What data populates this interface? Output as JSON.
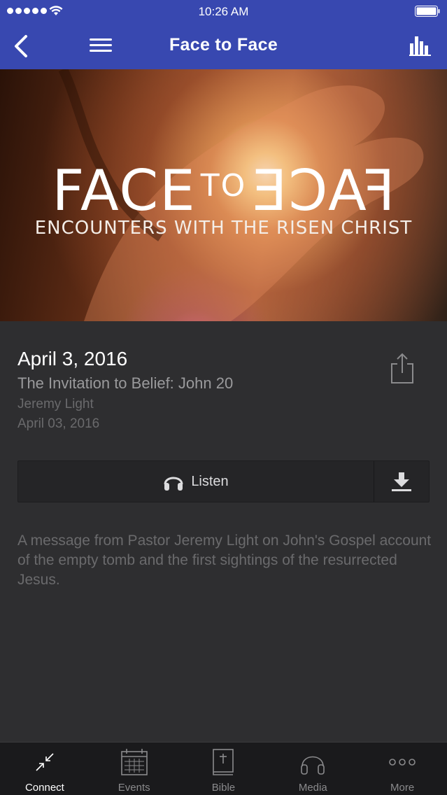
{
  "status_bar": {
    "time": "10:26 AM"
  },
  "nav": {
    "title": "Face to Face",
    "back_icon": "chevron-left-icon",
    "menu_icon": "hamburger-menu-icon",
    "stats_icon": "bar-chart-icon"
  },
  "hero": {
    "title_left": "FACE",
    "title_to": "TO",
    "title_right": "FACE",
    "subtitle": "ENCOUNTERS WITH THE RISEN CHRIST"
  },
  "sermon": {
    "date": "April 3, 2016",
    "title": "The Invitation to Belief: John 20",
    "speaker": "Jeremy Light",
    "published": "April 03, 2016",
    "description": "A message from Pastor Jeremy Light on John's Gospel account of the empty tomb and the first sightings of the resurrected Jesus."
  },
  "actions": {
    "listen_label": "Listen",
    "share_icon": "share-icon",
    "download_icon": "download-icon"
  },
  "tabs": [
    {
      "label": "Connect",
      "icon": "connect-icon",
      "active": true
    },
    {
      "label": "Events",
      "icon": "calendar-icon",
      "active": false
    },
    {
      "label": "Bible",
      "icon": "bible-icon",
      "active": false
    },
    {
      "label": "Media",
      "icon": "headphones-icon",
      "active": false
    },
    {
      "label": "More",
      "icon": "more-dots-icon",
      "active": false
    }
  ],
  "colors": {
    "nav_background": "#3848b0",
    "content_background": "#2e2e30",
    "tab_bar_background": "#1a1a1c"
  }
}
